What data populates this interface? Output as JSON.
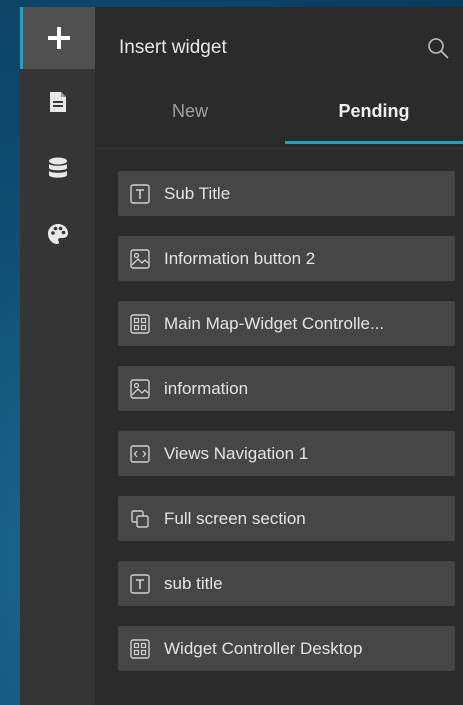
{
  "rail": {
    "items": [
      {
        "icon": "plus-icon",
        "active": true
      },
      {
        "icon": "page-icon",
        "active": false
      },
      {
        "icon": "database-icon",
        "active": false
      },
      {
        "icon": "palette-icon",
        "active": false
      }
    ]
  },
  "panel": {
    "title": "Insert widget",
    "search_icon": "search-icon",
    "tabs": [
      {
        "label": "New",
        "selected": false
      },
      {
        "label": "Pending",
        "selected": true
      }
    ],
    "accent_color": "#25a0b8",
    "widgets": [
      {
        "label": "Sub Title",
        "icon": "text-widget-icon"
      },
      {
        "label": "Information button 2",
        "icon": "image-widget-icon"
      },
      {
        "label": "Main Map-Widget Controlle...",
        "icon": "widget-controller-icon"
      },
      {
        "label": "information",
        "icon": "image-widget-icon"
      },
      {
        "label": "Views Navigation 1",
        "icon": "views-navigation-icon"
      },
      {
        "label": "Full screen section",
        "icon": "section-icon"
      },
      {
        "label": "sub title",
        "icon": "text-widget-icon"
      },
      {
        "label": "Widget Controller Desktop",
        "icon": "widget-controller-icon"
      }
    ]
  }
}
